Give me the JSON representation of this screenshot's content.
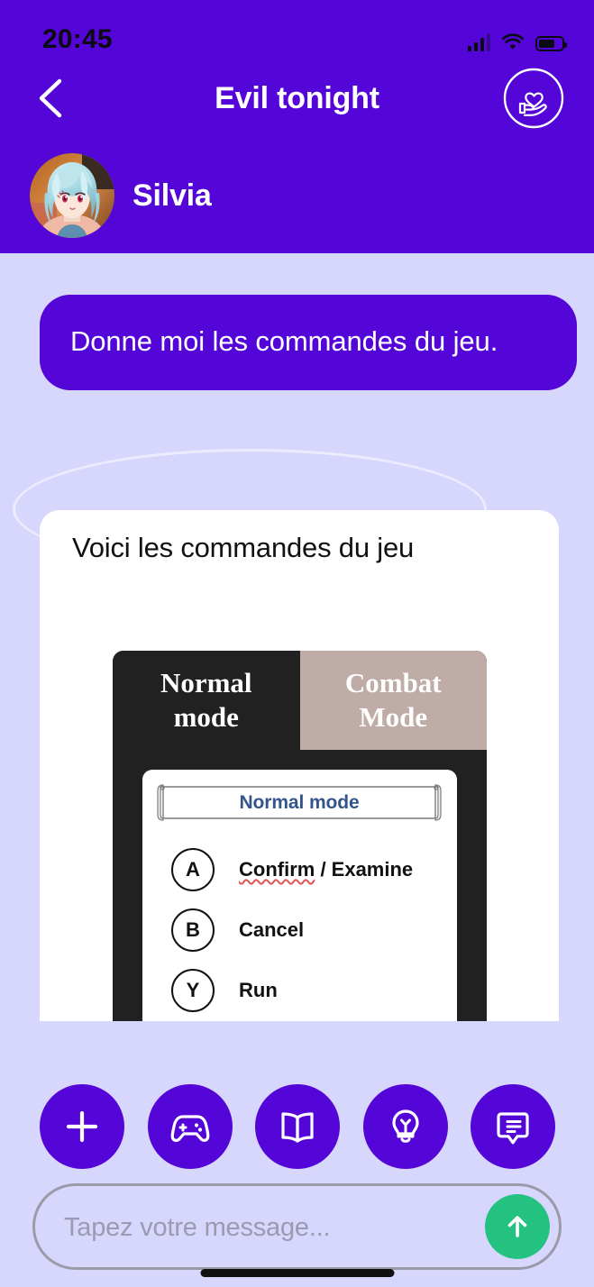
{
  "statusbar": {
    "time": "20:45",
    "signal_icon": "cellular-signal-icon",
    "wifi_icon": "wifi-icon",
    "battery_icon": "battery-icon",
    "battery_level": "62"
  },
  "header": {
    "title": "Evil tonight",
    "back_icon": "chevron-left-icon",
    "favorite_icon": "heart-in-hand-icon",
    "profile_name": "Silvia",
    "avatar_icon": "character-avatar",
    "background_color": "#5405D8"
  },
  "chat": {
    "messages": [
      {
        "role": "user",
        "text": "Donne moi les commandes du jeu."
      },
      {
        "role": "bot",
        "text": "Voici les commandes du jeu",
        "attachment": {
          "type": "game-controls-image",
          "tabs": [
            {
              "label_line1": "Normal",
              "label_line2": "mode",
              "active": true
            },
            {
              "label_line1": "Combat",
              "label_line2": "Mode",
              "active": false
            }
          ],
          "panel_title": "Normal mode",
          "controls": [
            {
              "key": "A",
              "action": "Confirm / Examine",
              "misspelled_word": "Confirm"
            },
            {
              "key": "B",
              "action": "Cancel"
            },
            {
              "key": "Y",
              "action": "Run"
            }
          ]
        }
      }
    ]
  },
  "actions": [
    {
      "name": "add",
      "icon": "plus-icon"
    },
    {
      "name": "games",
      "icon": "gamepad-icon"
    },
    {
      "name": "stories",
      "icon": "open-book-icon"
    },
    {
      "name": "ideas",
      "icon": "lightbulb-icon"
    },
    {
      "name": "chats",
      "icon": "chat-bubble-icon"
    }
  ],
  "composer": {
    "placeholder": "Tapez votre message...",
    "value": "",
    "send_icon": "arrow-up-icon",
    "send_color": "#24C281"
  },
  "colors": {
    "brand_purple": "#5405D8",
    "background_lavender": "#D7D6FD",
    "send_green": "#24C281",
    "panel_dark": "#212121",
    "tab_inactive": "#C0ACA6",
    "banner_blue": "#33558C"
  }
}
